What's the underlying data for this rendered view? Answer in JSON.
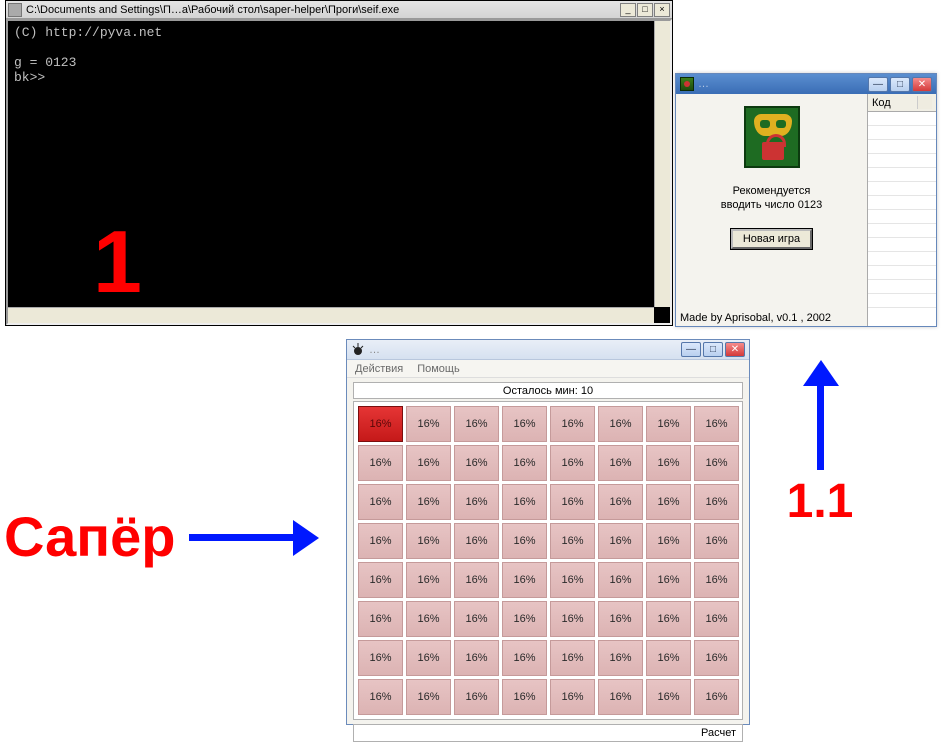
{
  "console": {
    "title": "C:\\Documents and Settings\\П…a\\Рабочий стол\\saper-helper\\Проги\\seif.exe",
    "line1": "(C) http://pyva.net",
    "line2": "g = 0123",
    "line3": "bk>>",
    "overlay_label": "1"
  },
  "helper": {
    "title_placeholder": "…",
    "reco_line1": "Рекомендуется",
    "reco_line2": "вводить число 0123",
    "new_game_label": "Новая игра",
    "footer": "Made by Aprisobal, v0.1 , 2002",
    "code_col": "Код"
  },
  "saper": {
    "title_placeholder": "…",
    "menu_actions": "Действия",
    "menu_help": "Помощь",
    "status": "Осталось мин: 10",
    "footer": "Расчет",
    "rows": 8,
    "cols": 8,
    "cell_label": "16%",
    "hot_label": "16%",
    "hot_index": 0
  },
  "anno": {
    "saper_label": "Сапёр",
    "one_one_label": "1.1"
  }
}
